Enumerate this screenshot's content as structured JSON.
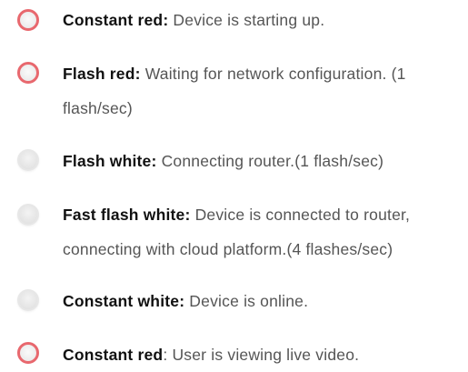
{
  "colors": {
    "red_ring": "#e8686e",
    "white_ring": "#e7e7e7",
    "label_text": "#111111",
    "body_text": "#555555"
  },
  "items": [
    {
      "color": "red",
      "label": "Constant red:",
      "description": " Device is starting up."
    },
    {
      "color": "red",
      "label": "Flash red:",
      "description": " Waiting for network configuration. (1 flash/sec)"
    },
    {
      "color": "white",
      "label": "Flash white:",
      "description": " Connecting router.(1 flash/sec)"
    },
    {
      "color": "white",
      "label": "Fast flash white:",
      "description": " Device is connected to router, connecting with cloud platform.(4 flashes/sec)"
    },
    {
      "color": "white",
      "label": "Constant white:",
      "description": " Device is online."
    },
    {
      "color": "red",
      "label": "Constant red",
      "description": ":  User is viewing live video."
    }
  ]
}
